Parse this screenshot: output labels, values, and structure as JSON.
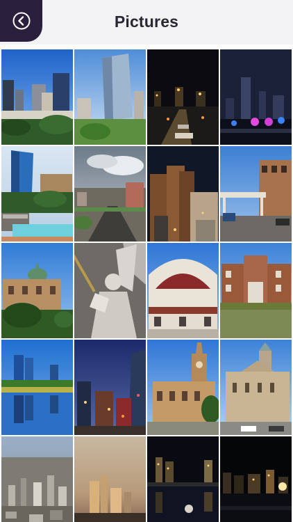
{
  "header": {
    "title": "Pictures",
    "back_icon": "chevron-left-icon",
    "bar_color": "#f3f3f5",
    "tab_color": "#2a1f3d"
  },
  "gallery": {
    "thumbnails": [
      {
        "name": "photo-fort-worth-downtown-day"
      },
      {
        "name": "photo-glass-office-tower"
      },
      {
        "name": "photo-skyline-night-road"
      },
      {
        "name": "photo-night-skyline-lights"
      },
      {
        "name": "photo-blue-tower-water-garden"
      },
      {
        "name": "photo-aerial-avenue"
      },
      {
        "name": "photo-brick-towers-night"
      },
      {
        "name": "photo-stockyards-street"
      },
      {
        "name": "photo-domed-courthouse"
      },
      {
        "name": "photo-angel-statue"
      },
      {
        "name": "photo-arched-coliseum"
      },
      {
        "name": "photo-brick-school-building"
      },
      {
        "name": "photo-skyline-lake-reflection"
      },
      {
        "name": "photo-city-dusk-towers"
      },
      {
        "name": "photo-clock-tower-courthouse"
      },
      {
        "name": "photo-courthouse-plaza"
      },
      {
        "name": "photo-aerial-city"
      },
      {
        "name": "photo-skyline-sunset"
      },
      {
        "name": "photo-night-river-reflection"
      },
      {
        "name": "photo-night-skyline-dark"
      }
    ]
  }
}
